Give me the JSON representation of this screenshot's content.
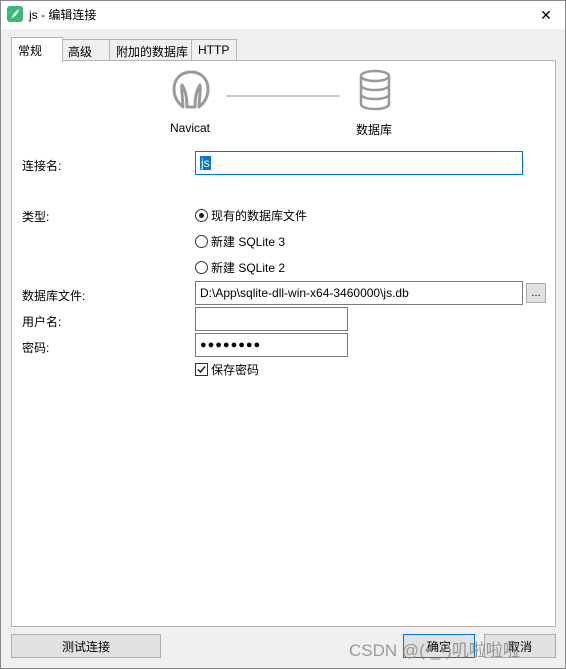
{
  "window": {
    "title": "js - 编辑连接",
    "close_glyph": "✕"
  },
  "tabs": [
    {
      "label": "常规",
      "active": true
    },
    {
      "label": "高级",
      "active": false
    },
    {
      "label": "附加的数据库",
      "active": false
    },
    {
      "label": "HTTP",
      "active": false
    }
  ],
  "graphic": {
    "left_label": "Navicat",
    "right_label": "数据库"
  },
  "form": {
    "connection_name_label": "连接名:",
    "connection_name_value": "js",
    "type_label": "类型:",
    "type_options": [
      {
        "label": "现有的数据库文件",
        "checked": true
      },
      {
        "label": "新建 SQLite 3",
        "checked": false
      },
      {
        "label": "新建 SQLite 2",
        "checked": false
      }
    ],
    "db_file_label": "数据库文件:",
    "db_file_value": "D:\\App\\sqlite-dll-win-x64-3460000\\js.db",
    "browse_label": "...",
    "username_label": "用户名:",
    "username_value": "",
    "password_label": "密码:",
    "password_value": "●●●●●●●●",
    "save_password_label": "保存密码",
    "save_password_checked": true
  },
  "buttons": {
    "test_connection": "测试连接",
    "ok": "确定",
    "cancel": "取消"
  },
  "watermark": "CSDN @(•̀_•́)叽啦啦啦",
  "colors": {
    "accent": "#0078d7",
    "icon_gray": "#9a9a9a"
  },
  "icons": {
    "app": "navicat-feather-icon",
    "close": "close-icon",
    "navicat": "navicat-logo-icon",
    "database": "database-icon",
    "checkmark": "checkmark-icon"
  }
}
